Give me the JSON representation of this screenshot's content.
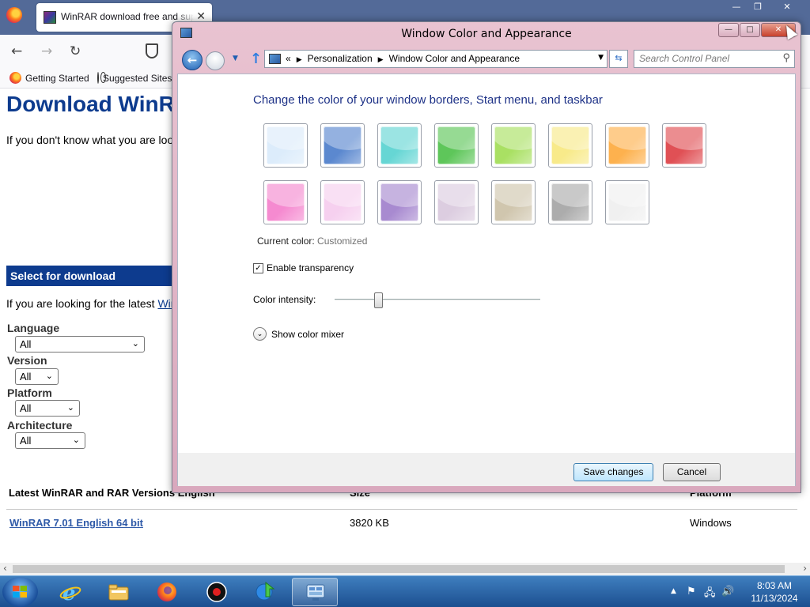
{
  "browser": {
    "tab_title": "WinRAR download free and support: WinRAR",
    "tab_close": "✕",
    "window_controls": {
      "minimize": "—",
      "maximize": "❐",
      "close": "✕"
    },
    "nav": {
      "back": "←",
      "forward": "→",
      "reload": "↻"
    },
    "bookmarks": [
      {
        "label": "Getting Started"
      },
      {
        "label": "Suggested Sites"
      }
    ]
  },
  "page": {
    "heading": "Download WinRAR",
    "intro": "If you don't know what you are looking for",
    "select_bar": "Select for download",
    "latest_prefix": "If you are looking for the latest ",
    "latest_link": "WinRAR",
    "filters": [
      {
        "label": "Language",
        "value": "All"
      },
      {
        "label": "Version",
        "value": "All"
      },
      {
        "label": "Platform",
        "value": "All"
      },
      {
        "label": "Architecture",
        "value": "All"
      }
    ],
    "table": {
      "headers": {
        "name": "Latest WinRAR and RAR Versions English",
        "size": "Size",
        "platform": "Platform"
      },
      "rows": [
        {
          "name": "WinRAR 7.01 English 64 bit",
          "size": "3820 KB",
          "platform": "Windows"
        }
      ]
    }
  },
  "dialog": {
    "title": "Window Color and Appearance",
    "controls": {
      "minimize": "—",
      "maximize": "□",
      "close": "✕"
    },
    "breadcrumbs": [
      "«",
      "Personalization",
      "Window Color and Appearance"
    ],
    "search_placeholder": "Search Control Panel",
    "heading": "Change the color of your window borders, Start menu, and taskbar",
    "swatches": [
      {
        "name": "sky",
        "color": "#dcecfb"
      },
      {
        "name": "twilight",
        "color": "#5b88cf"
      },
      {
        "name": "sea",
        "color": "#66d6d4"
      },
      {
        "name": "leaf",
        "color": "#5ec65a"
      },
      {
        "name": "lime",
        "color": "#a9e063"
      },
      {
        "name": "lemon",
        "color": "#f8ea8a"
      },
      {
        "name": "pumpkin",
        "color": "#fdb14e"
      },
      {
        "name": "ruby",
        "color": "#e05055"
      },
      {
        "name": "fuchsia",
        "color": "#f58ad0"
      },
      {
        "name": "blush",
        "color": "#f6d0ef"
      },
      {
        "name": "violet",
        "color": "#a88ad0"
      },
      {
        "name": "lavender",
        "color": "#dccde0"
      },
      {
        "name": "taupe",
        "color": "#d0c6ae"
      },
      {
        "name": "chocolate",
        "color": "#acacac"
      },
      {
        "name": "frost",
        "color": "#f0f0f0"
      }
    ],
    "current_color_label": "Current color:",
    "current_color_value": "Customized",
    "transparency_label": "Enable transparency",
    "transparency_checked": true,
    "intensity_label": "Color intensity:",
    "intensity_level": 0.21,
    "mixer_label": "Show color mixer",
    "save_label": "Save changes",
    "cancel_label": "Cancel"
  },
  "taskbar": {
    "time": "8:03 AM",
    "date": "11/13/2024"
  }
}
